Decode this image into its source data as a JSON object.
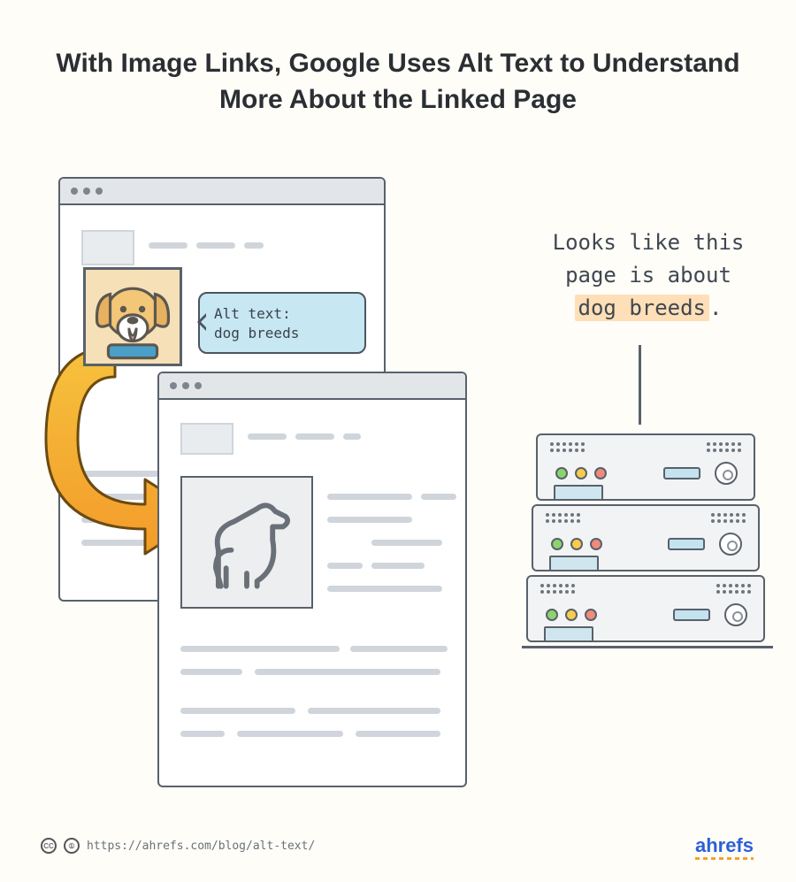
{
  "title": "With Image Links, Google Uses Alt Text to Understand More About the Linked Page",
  "bubble": {
    "label": "Alt text:",
    "value": "dog breeds"
  },
  "server_caption": {
    "part1": "Looks like this",
    "part2": "page is about",
    "highlight": "dog breeds",
    "tail": "."
  },
  "footer": {
    "url": "https://ahrefs.com/blog/alt-text/",
    "brand": "ahrefs"
  },
  "icons": {
    "dog_photo": "dog-face-icon",
    "dog_silhouette": "dog-outline-icon",
    "arrow": "curved-arrow-icon",
    "server": "server-icon",
    "cc": "cc-icon",
    "by": "by-icon"
  }
}
